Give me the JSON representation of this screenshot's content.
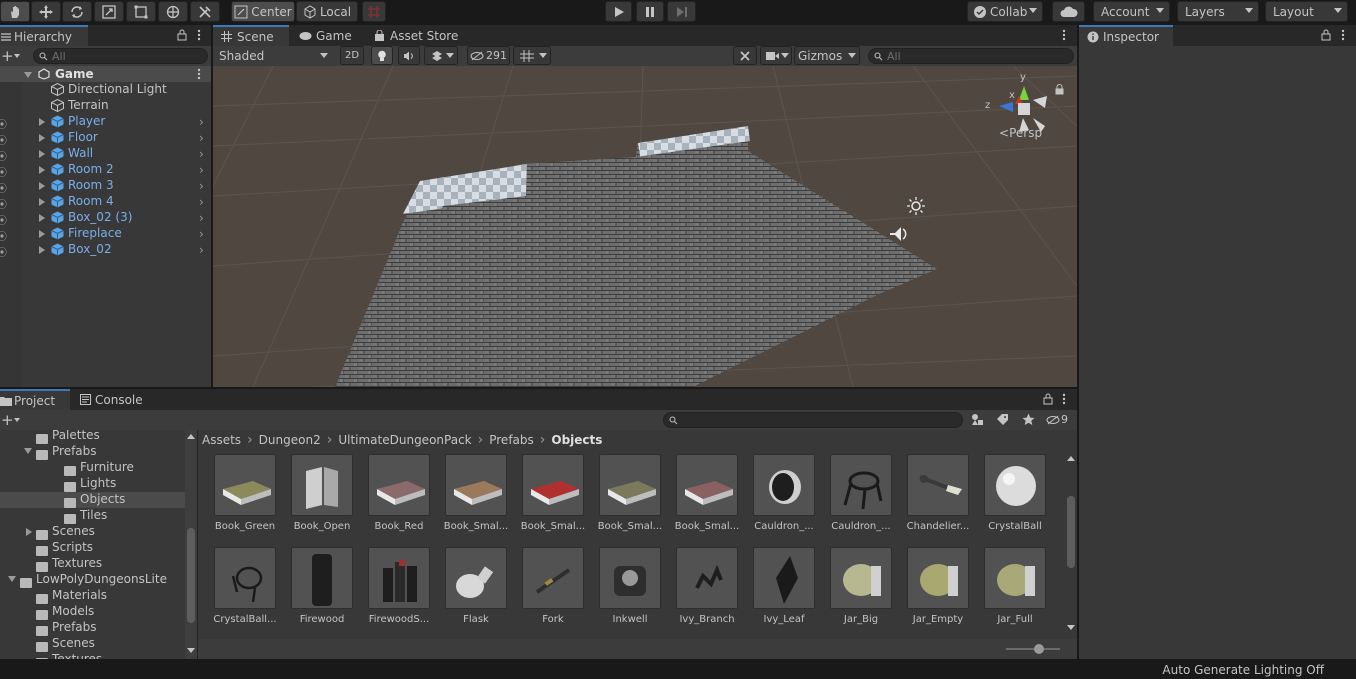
{
  "toolbar": {
    "pivot_label": "Center",
    "rotation_label": "Local",
    "collab_label": "Collab",
    "account_label": "Account",
    "layers_label": "Layers",
    "layout_label": "Layout"
  },
  "hierarchy": {
    "tab_label": "Hierarchy",
    "search_placeholder": "All",
    "scene_name": "Game",
    "items": [
      {
        "label": "Directional Light",
        "prefab": false
      },
      {
        "label": "Terrain",
        "prefab": false
      },
      {
        "label": "Player",
        "prefab": true
      },
      {
        "label": "Floor",
        "prefab": true
      },
      {
        "label": "Wall",
        "prefab": true
      },
      {
        "label": "Room 2",
        "prefab": true
      },
      {
        "label": "Room 3",
        "prefab": true
      },
      {
        "label": "Room 4",
        "prefab": true
      },
      {
        "label": "Box_02 (3)",
        "prefab": true
      },
      {
        "label": "Fireplace",
        "prefab": true
      },
      {
        "label": "Box_02",
        "prefab": true
      }
    ]
  },
  "scene": {
    "tabs": [
      "Scene",
      "Game",
      "Asset Store"
    ],
    "shading_mode": "Shaded",
    "mode_2d": "2D",
    "hidden_count": "291",
    "gizmos_label": "Gizmos",
    "search_placeholder": "All",
    "persp_label": "Persp",
    "axis_y": "y",
    "axis_x": "x",
    "axis_z": "z"
  },
  "inspector": {
    "tab_label": "Inspector"
  },
  "project": {
    "tabs": [
      "Project",
      "Console"
    ],
    "hidden_count": "9",
    "breadcrumb": [
      "Assets",
      "Dungeon2",
      "UltimateDungeonPack",
      "Prefabs",
      "Objects"
    ],
    "tree": [
      {
        "label": "Palettes",
        "indent": 1,
        "arrow": ""
      },
      {
        "label": "Prefabs",
        "indent": 1,
        "arrow": "open"
      },
      {
        "label": "Furniture",
        "indent": 2,
        "arrow": ""
      },
      {
        "label": "Lights",
        "indent": 2,
        "arrow": ""
      },
      {
        "label": "Objects",
        "indent": 2,
        "arrow": ""
      },
      {
        "label": "Tiles",
        "indent": 2,
        "arrow": ""
      },
      {
        "label": "Scenes",
        "indent": 1,
        "arrow": "closed"
      },
      {
        "label": "Scripts",
        "indent": 1,
        "arrow": ""
      },
      {
        "label": "Textures",
        "indent": 1,
        "arrow": ""
      },
      {
        "label": "LowPolyDungeonsLite",
        "indent": 0,
        "arrow": "open"
      },
      {
        "label": "Materials",
        "indent": 1,
        "arrow": ""
      },
      {
        "label": "Models",
        "indent": 1,
        "arrow": ""
      },
      {
        "label": "Prefabs",
        "indent": 1,
        "arrow": ""
      },
      {
        "label": "Scenes",
        "indent": 1,
        "arrow": ""
      },
      {
        "label": "Textures",
        "indent": 1,
        "arrow": ""
      }
    ],
    "assets": [
      {
        "label": "Book_Green",
        "kind": "book",
        "color": "#8a8a5a"
      },
      {
        "label": "Book_Open",
        "kind": "bookopen",
        "color": "#c8c8c8"
      },
      {
        "label": "Book_Red",
        "kind": "book",
        "color": "#8a6a6a"
      },
      {
        "label": "Book_Smal...",
        "kind": "book",
        "color": "#9a7a5a"
      },
      {
        "label": "Book_Smal...",
        "kind": "book",
        "color": "#b03030"
      },
      {
        "label": "Book_Smal...",
        "kind": "book",
        "color": "#7a7a5a"
      },
      {
        "label": "Book_Smal...",
        "kind": "book",
        "color": "#8a6060"
      },
      {
        "label": "Cauldron_...",
        "kind": "cauldron",
        "color": "#2a2a2a"
      },
      {
        "label": "Cauldron_...",
        "kind": "cauldron2",
        "color": "#1e1e1e"
      },
      {
        "label": "Chandelier...",
        "kind": "chandelier",
        "color": "#9a9a7a"
      },
      {
        "label": "CrystalBall",
        "kind": "ball",
        "color": "#d8d8d8"
      },
      {
        "label": "CrystalBall...",
        "kind": "stand",
        "color": "#2a2a2a"
      },
      {
        "label": "Firewood",
        "kind": "firewood",
        "color": "#2a2a2a"
      },
      {
        "label": "FirewoodS...",
        "kind": "firewoods",
        "color": "#2a2a2a"
      },
      {
        "label": "Flask",
        "kind": "flask",
        "color": "#cfcfcf"
      },
      {
        "label": "Fork",
        "kind": "fork",
        "color": "#4a4a3a"
      },
      {
        "label": "Inkwell",
        "kind": "inkwell",
        "color": "#3a3a3a"
      },
      {
        "label": "Ivy_Branch",
        "kind": "ivy",
        "color": "#2a2a2a"
      },
      {
        "label": "Ivy_Leaf",
        "kind": "leaf",
        "color": "#2a2a2a"
      },
      {
        "label": "Jar_Big",
        "kind": "jar",
        "color": "#b8b890"
      },
      {
        "label": "Jar_Empty",
        "kind": "jar",
        "color": "#a8a870"
      },
      {
        "label": "Jar_Full",
        "kind": "jar",
        "color": "#a8a878"
      }
    ]
  },
  "status": {
    "text": "Auto Generate Lighting Off"
  }
}
